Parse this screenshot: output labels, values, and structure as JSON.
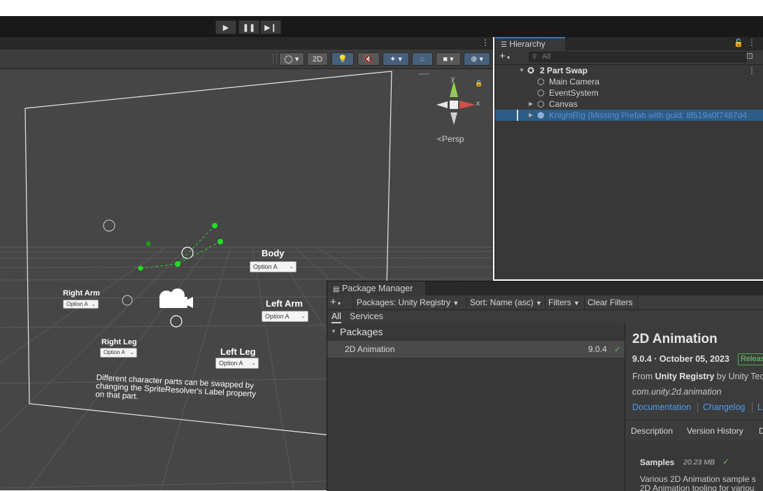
{
  "toolbar": {
    "play_icon": "play-icon",
    "pause_icon": "pause-icon",
    "step_icon": "step-icon"
  },
  "scene": {
    "toolbar": {
      "mode_2d_label": "2D"
    },
    "gizmo": {
      "x_label": "x",
      "y_label": "y",
      "persp_label": "Persp"
    },
    "canvas_ui": {
      "body_label": "Body",
      "body_option": "Option A",
      "right_arm_label": "Right Arm",
      "right_arm_option": "Option A",
      "left_arm_label": "Left Arm",
      "left_arm_option": "Option A",
      "right_leg_label": "Right Leg",
      "right_leg_option": "Option A",
      "left_leg_label": "Left Leg",
      "left_leg_option": "Option A",
      "note_line1": "Different character parts can be swapped by",
      "note_line2": "changing the SpriteResolver's Label property",
      "note_line3": "on that part."
    }
  },
  "hierarchy": {
    "tab_label": "Hierarchy",
    "add_label": "+",
    "search_placeholder": "All",
    "scene_name": "2 Part Swap",
    "items": [
      {
        "label": "Main Camera"
      },
      {
        "label": "EventSystem"
      },
      {
        "label": "Canvas"
      },
      {
        "label": "KnightRig (Missing Prefab with guid: 8f519a0f7487d4"
      }
    ]
  },
  "package_manager": {
    "tab_label": "Package Manager",
    "add_label": "+",
    "registry_filter": "Packages: Unity Registry",
    "sort_label": "Sort: Name (asc)",
    "filters_label": "Filters",
    "clear_filters_label": "Clear Filters",
    "subtabs": [
      "All",
      "Services"
    ],
    "group_label": "Packages",
    "packages": [
      {
        "name": "2D Animation",
        "version": "9.0.4"
      }
    ],
    "detail": {
      "title": "2D Animation",
      "version_date": "9.0.4 · October 05, 2023",
      "release_badge": "Releas",
      "from_prefix": "From",
      "registry": "Unity Registry",
      "by_text": "by Unity Tec",
      "package_id": "com.unity.2d.animation",
      "links": [
        "Documentation",
        "Changelog",
        "L"
      ],
      "tabs": [
        "Description",
        "Version History",
        "D"
      ],
      "samples_label": "Samples",
      "samples_size": "20.23 MB",
      "samples_desc1": "Various 2D Animation sample s",
      "samples_desc2": "2D Animation tooling for variou"
    }
  },
  "colors": {
    "selection": "#2c5d87",
    "missing_prefab_text": "#5a8fd0",
    "link": "#4c9bef",
    "release_badge": "#4cae4c",
    "gizmo_x": "#d0504a",
    "gizmo_y": "#8ed43e",
    "bone_joint": "#22cc22"
  }
}
